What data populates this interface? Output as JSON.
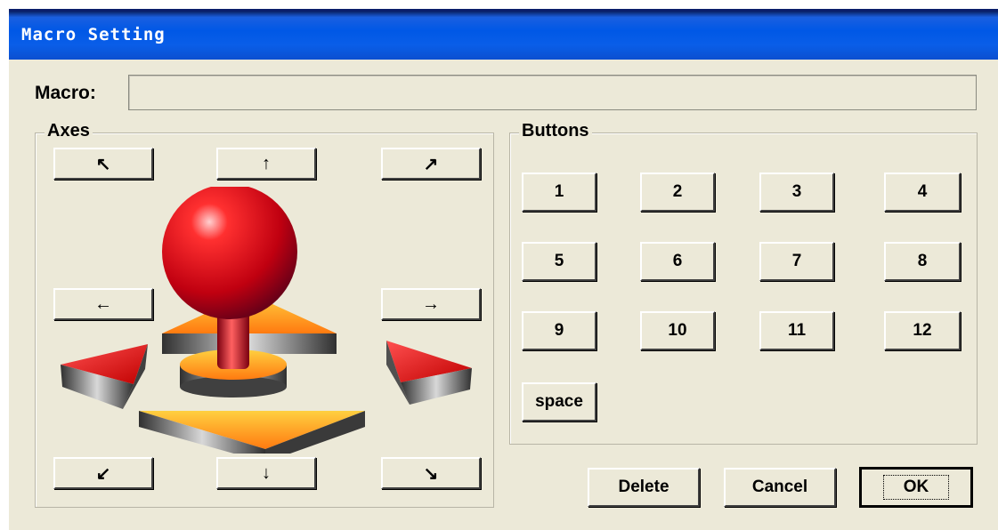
{
  "window": {
    "title": "Macro Setting"
  },
  "macro": {
    "label": "Macro:",
    "value": ""
  },
  "axes": {
    "label": "Axes",
    "buttons": {
      "up_left": "↖",
      "up": "↑",
      "up_right": "↗",
      "left": "←",
      "right": "→",
      "down_left": "↙",
      "down": "↓",
      "down_right": "↘"
    }
  },
  "buttons_group": {
    "label": "Buttons",
    "keys": [
      "1",
      "2",
      "3",
      "4",
      "5",
      "6",
      "7",
      "8",
      "9",
      "10",
      "11",
      "12",
      "space"
    ]
  },
  "actions": {
    "delete": "Delete",
    "cancel": "Cancel",
    "ok": "OK"
  },
  "colors": {
    "title_bar": "#0058e6",
    "dialog_bg": "#ece9d8",
    "joystick_red": "#e01010",
    "joystick_orange": "#f5a020"
  }
}
